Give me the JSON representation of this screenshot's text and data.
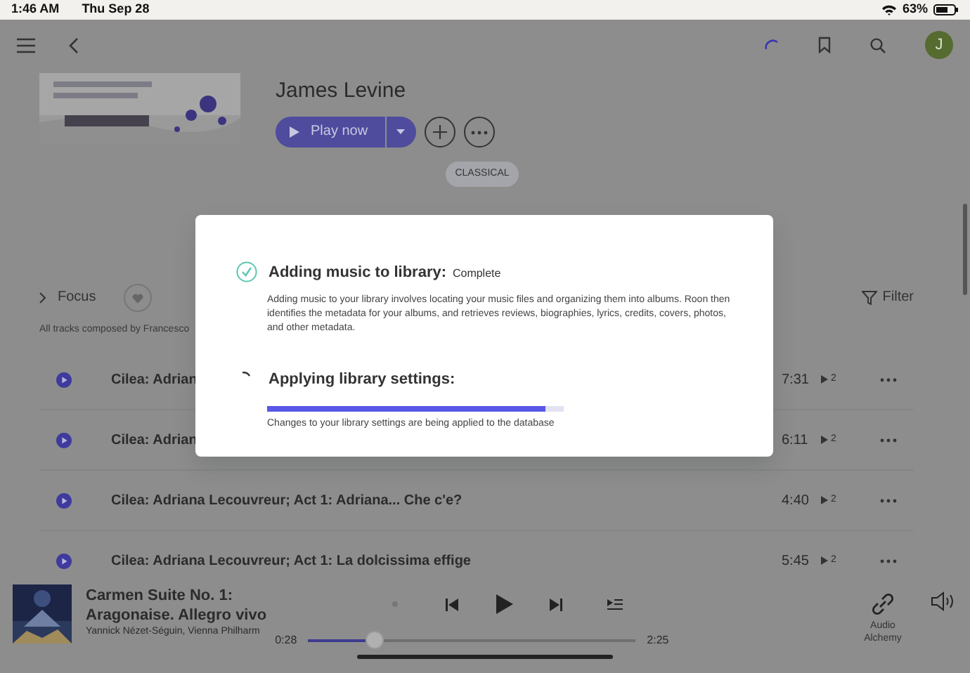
{
  "status_bar": {
    "time": "1:46 AM",
    "date": "Thu Sep 28",
    "battery": "63%"
  },
  "top_bar": {
    "avatar": "J"
  },
  "album": {
    "artist": "James Levine",
    "play_button": "Play now",
    "genre": "CLASSICAL"
  },
  "focus": {
    "label": "Focus",
    "filter": "Filter",
    "composer_note": "All tracks composed by Francesco"
  },
  "tracks": [
    {
      "title": "Cilea: Adrian",
      "duration": "7:31",
      "plays": "2"
    },
    {
      "title": "Cilea: Adrian",
      "duration": "6:11",
      "plays": "2"
    },
    {
      "title": "Cilea: Adriana Lecouvreur; Act 1: Adriana... Che c'e?",
      "duration": "4:40",
      "plays": "2"
    },
    {
      "title": "Cilea: Adriana Lecouvreur; Act 1: La dolcissima effige",
      "duration": "5:45",
      "plays": "2"
    }
  ],
  "dialog": {
    "steps": [
      {
        "kind": "done",
        "title": "Adding music to library:",
        "status": "Complete",
        "description": "Adding music to your library involves locating your music files and organizing them into albums. Roon then identifies the metadata for your albums, and retrieves reviews, biographies, lyrics, credits, covers, photos, and other metadata."
      },
      {
        "kind": "running",
        "title": "Applying library settings:",
        "level": 0.94,
        "description": "Changes to your library settings are being applied to the database"
      }
    ]
  },
  "now_playing": {
    "title_lines": [
      "Carmen Suite No. 1:",
      "Aragonaise. Allegro vivo"
    ],
    "artist": "Yannick Nézet-Séguin, Vienna Philharm",
    "elapsed": "0:28",
    "total": "2:25",
    "level": 0.2,
    "zone": "Audio Alchemy"
  }
}
